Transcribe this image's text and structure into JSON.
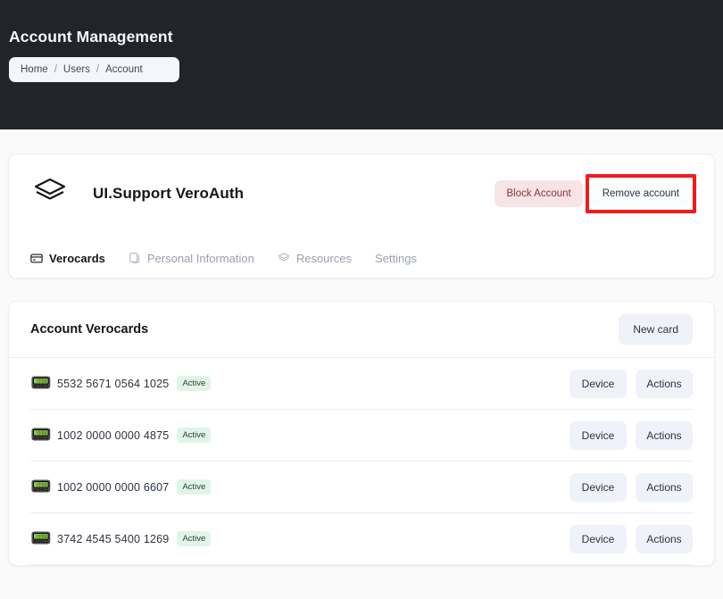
{
  "header": {
    "title": "Account Management",
    "breadcrumb": [
      {
        "label": "Home"
      },
      {
        "label": "Users"
      },
      {
        "label": "Account"
      }
    ],
    "separator": "/"
  },
  "account": {
    "logo_icon": "layers-icon",
    "name": "UI.Support VeroAuth",
    "block_button": "Block Account",
    "remove_button": "Remove account",
    "highlight_color": "#ee1c1c"
  },
  "tabs": [
    {
      "label": "Verocards",
      "icon": "credit-card-icon",
      "active": true
    },
    {
      "label": "Personal Information",
      "icon": "copy-icon",
      "active": false
    },
    {
      "label": "Resources",
      "icon": "layers-icon",
      "active": false
    },
    {
      "label": "Settings",
      "icon": "",
      "active": false
    }
  ],
  "verocards": {
    "title": "Account Verocards",
    "new_card_button": "New card",
    "row_icon": "pager-device-icon",
    "device_button": "Device",
    "actions_button": "Actions",
    "rows": [
      {
        "number": "5532 5671 0564 1025",
        "status": "Active"
      },
      {
        "number": "1002 0000 0000 4875",
        "status": "Active"
      },
      {
        "number": "1002 0000 0000 6607",
        "status": "Active"
      },
      {
        "number": "3742 4545 5400 1269",
        "status": "Active"
      }
    ]
  },
  "colors": {
    "header_bg": "#212529",
    "page_bg": "#fafafa",
    "badge_bg": "#e1f4e9",
    "button_bg": "#eff2f9",
    "block_bg": "#f7e4e7"
  }
}
